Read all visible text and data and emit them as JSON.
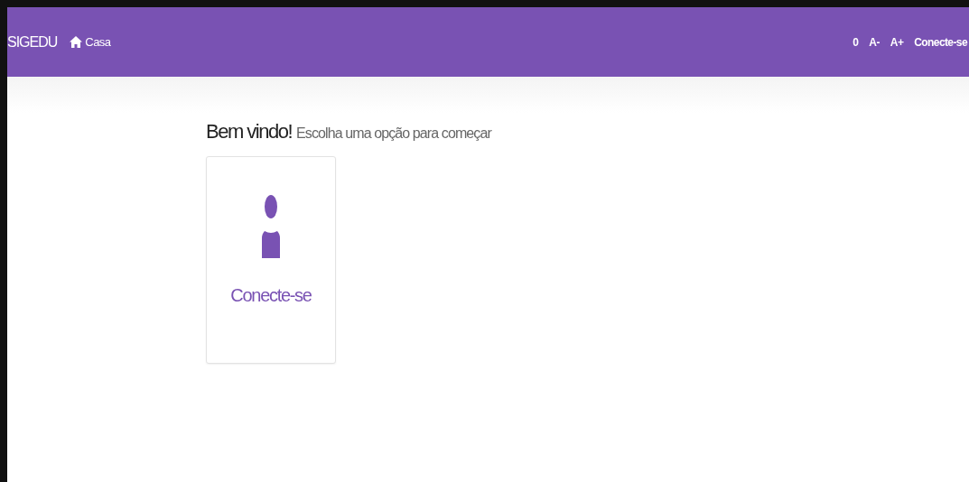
{
  "navbar": {
    "brand": "SIGEDU",
    "home_link": "Casa",
    "right_items": [
      "0",
      "A-",
      "A+",
      "Conecte-se"
    ]
  },
  "welcome": {
    "title": "Bem vindo!",
    "subtitle": "Escolha uma opção para começar"
  },
  "options": [
    {
      "label": "Conecte-se"
    }
  ]
}
